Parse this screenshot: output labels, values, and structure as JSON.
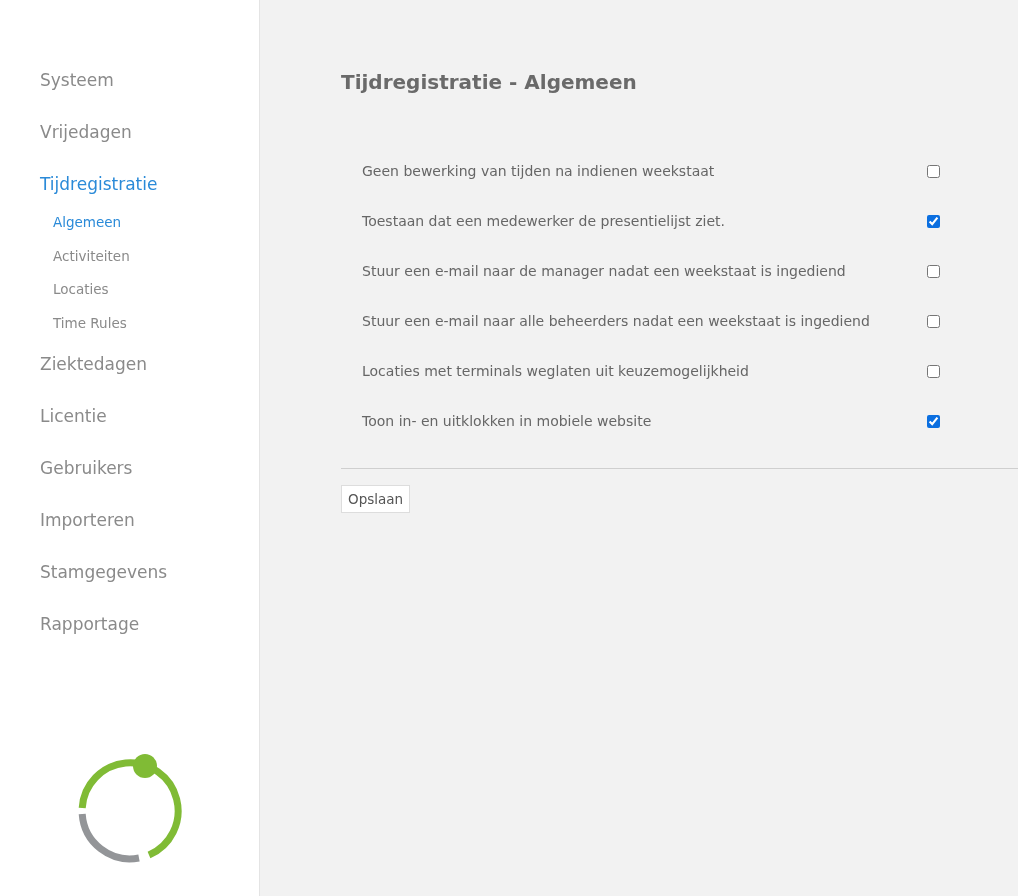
{
  "sidebar": {
    "items": [
      {
        "label": "Systeem",
        "selected": false
      },
      {
        "label": "Vrijedagen",
        "selected": false
      },
      {
        "label": "Tijdregistratie",
        "selected": true,
        "children": [
          {
            "label": "Algemeen",
            "selected": true
          },
          {
            "label": "Activiteiten",
            "selected": false
          },
          {
            "label": "Locaties",
            "selected": false
          },
          {
            "label": "Time Rules",
            "selected": false
          }
        ]
      },
      {
        "label": "Ziektedagen",
        "selected": false
      },
      {
        "label": "Licentie",
        "selected": false
      },
      {
        "label": "Gebruikers",
        "selected": false
      },
      {
        "label": "Importeren",
        "selected": false
      },
      {
        "label": "Stamgegevens",
        "selected": false
      },
      {
        "label": "Rapportage",
        "selected": false
      }
    ]
  },
  "page": {
    "title": "Tijdregistratie - Algemeen",
    "settings": [
      {
        "label": "Geen bewerking van tijden na indienen weekstaat",
        "checked": false
      },
      {
        "label": "Toestaan dat een medewerker de presentielijst ziet.",
        "checked": true
      },
      {
        "label": "Stuur een e-mail naar de manager nadat een weekstaat is ingediend",
        "checked": false
      },
      {
        "label": "Stuur een e-mail naar alle beheerders nadat een weekstaat is ingediend",
        "checked": false
      },
      {
        "label": "Locaties met terminals weglaten uit keuzemogelijkheid",
        "checked": false
      },
      {
        "label": "Toon in- en uitklokken in mobiele website",
        "checked": true
      }
    ],
    "save_button": "Opslaan"
  }
}
